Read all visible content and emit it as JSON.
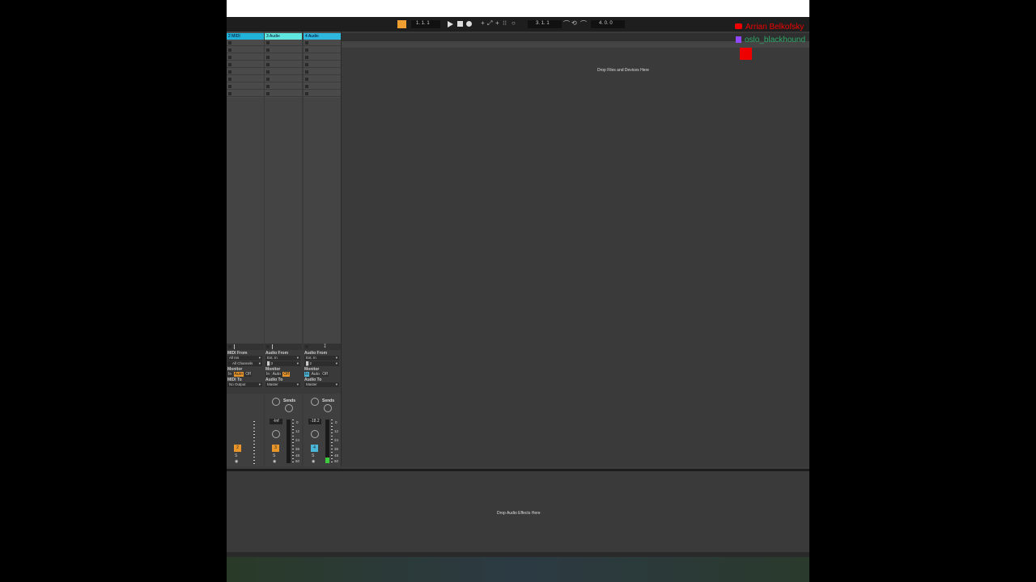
{
  "transport": {
    "position": "1.  1.  1",
    "loop_start": "3.  1.  1",
    "loop_length": "4.  0.  0"
  },
  "tracks": [
    {
      "name": "2 MIDI",
      "header_color": "#20b2d8",
      "io": {
        "from_label": "MIDI From",
        "from_value": "All Ins",
        "channel_value": "All Channels",
        "monitor_label": "Monitor",
        "monitor_in": "In",
        "monitor_auto": "Auto",
        "monitor_off": "Off",
        "to_label": "MIDI To",
        "to_value": "No Output"
      },
      "number": "2",
      "number_color": "#e8952a",
      "solo": "S"
    },
    {
      "name": "3 Audio",
      "header_color": "#5ee8e0",
      "io": {
        "from_label": "Audio From",
        "from_value": "Ext. In",
        "channel_value": "█ 3",
        "monitor_label": "Monitor",
        "monitor_in": "In",
        "monitor_auto": "Auto",
        "monitor_off": "Off",
        "to_label": "Audio To",
        "to_value": "Master"
      },
      "sends_label": "Sends",
      "volume": "-Inf",
      "number": "3",
      "number_color": "#e8952a",
      "solo": "S"
    },
    {
      "name": "4 Audio",
      "header_color": "#2eb8e0",
      "io": {
        "from_label": "Audio From",
        "from_value": "Ext. In",
        "channel_value": "█ 2",
        "monitor_label": "Monitor",
        "monitor_in": "In",
        "monitor_auto": "Auto",
        "monitor_off": "Off",
        "to_label": "Audio To",
        "to_value": "Master"
      },
      "sends_label": "Sends",
      "volume": "-18.2",
      "number": "4",
      "number_color": "#4ab8d8",
      "solo": "S"
    }
  ],
  "meter_scale": [
    "0",
    "12",
    "24",
    "36",
    "48",
    "60"
  ],
  "drop_files_text": "Drop Files and Devices Here",
  "drop_effects_text": "Drop Audio Effects Here",
  "stream_overlay": {
    "youtube_user": "Arrian Belkofsky",
    "twitch_user": "oslo_blackhound"
  }
}
